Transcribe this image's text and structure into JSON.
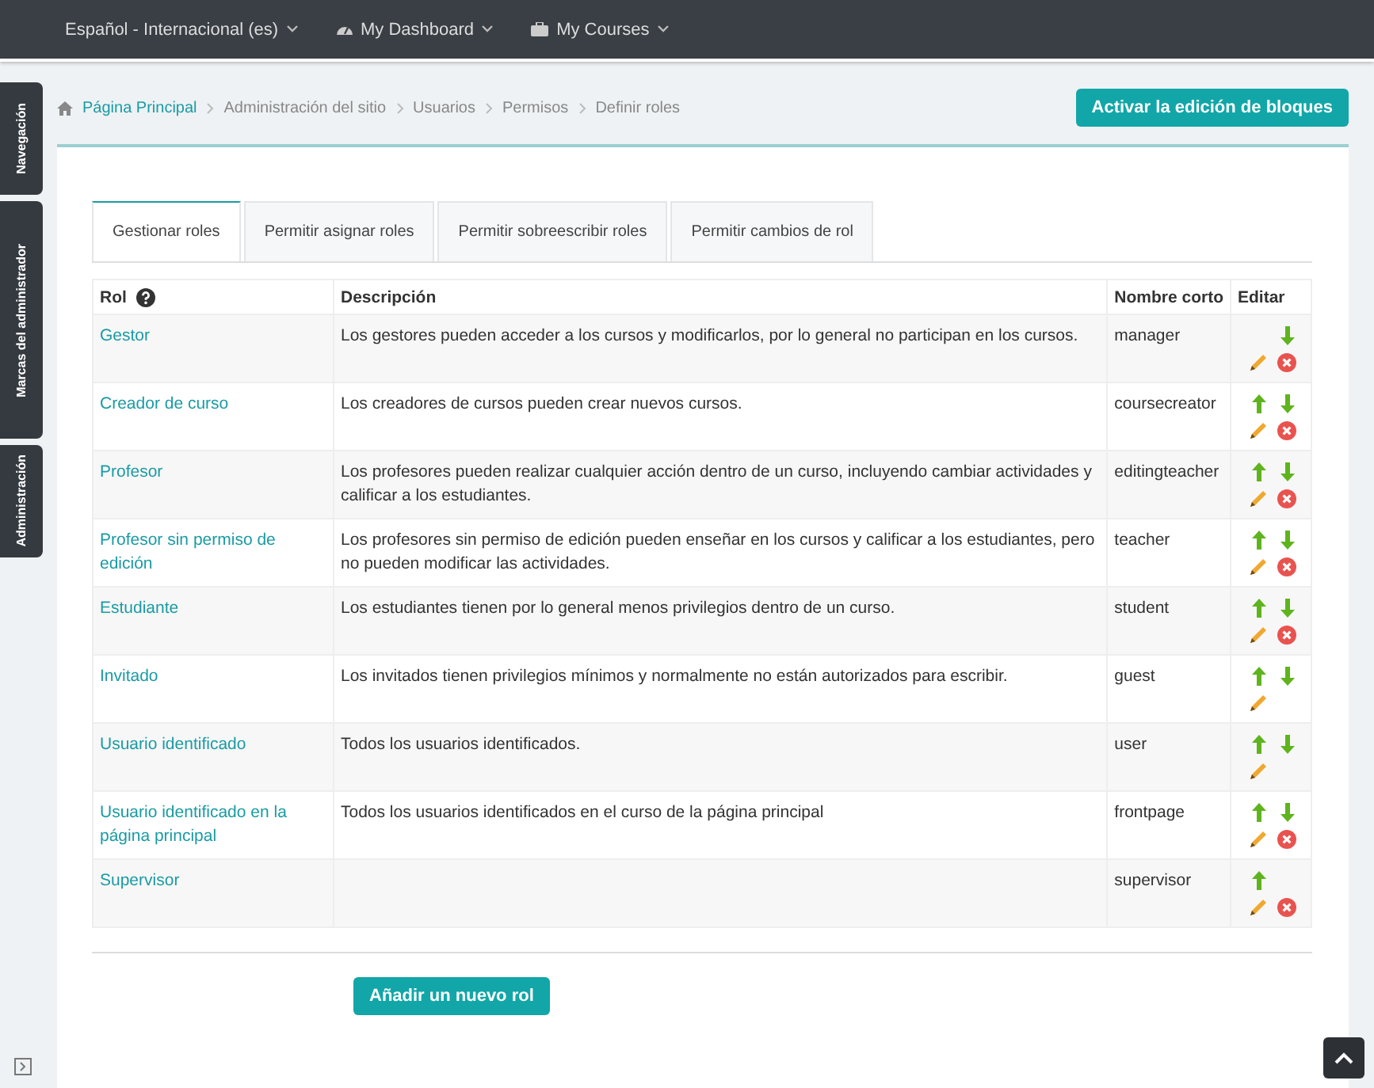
{
  "navbar": {
    "items": [
      {
        "label": "Español - Internacional (es)"
      },
      {
        "label": "My Dashboard"
      },
      {
        "label": "My Courses"
      }
    ]
  },
  "side_tabs": [
    "Navegación",
    "Marcas del administrador",
    "Administración"
  ],
  "breadcrumb": [
    {
      "label": "Página Principal",
      "link": true
    },
    {
      "label": "Administración del sitio",
      "link": false
    },
    {
      "label": "Usuarios",
      "link": false
    },
    {
      "label": "Permisos",
      "link": false
    },
    {
      "label": "Definir roles",
      "link": false
    }
  ],
  "edit_blocks_button": "Activar la edición de bloques",
  "tabs": [
    {
      "label": "Gestionar roles",
      "selected": true
    },
    {
      "label": "Permitir asignar roles",
      "selected": false
    },
    {
      "label": "Permitir sobreescribir roles",
      "selected": false
    },
    {
      "label": "Permitir cambios de rol",
      "selected": false
    }
  ],
  "table": {
    "columns": [
      "Rol",
      "Descripción",
      "Nombre corto",
      "Editar"
    ],
    "rows": [
      {
        "role": "Gestor",
        "description": "Los gestores pueden acceder a los cursos y modificarlos, por lo general no participan en los cursos.",
        "shortname": "manager",
        "up": false,
        "down": true,
        "delete": true
      },
      {
        "role": "Creador de curso",
        "description": "Los creadores de cursos pueden crear nuevos cursos.",
        "shortname": "coursecreator",
        "up": true,
        "down": true,
        "delete": true
      },
      {
        "role": "Profesor",
        "description": "Los profesores pueden realizar cualquier acción dentro de un curso, incluyendo cambiar actividades y calificar a los estudiantes.",
        "shortname": "editingteacher",
        "up": true,
        "down": true,
        "delete": true
      },
      {
        "role": "Profesor sin permiso de edición",
        "description": "Los profesores sin permiso de edición pueden enseñar en los cursos y calificar a los estudiantes, pero no pueden modificar las actividades.",
        "shortname": "teacher",
        "up": true,
        "down": true,
        "delete": true
      },
      {
        "role": "Estudiante",
        "description": "Los estudiantes tienen por lo general menos privilegios dentro de un curso.",
        "shortname": "student",
        "up": true,
        "down": true,
        "delete": true
      },
      {
        "role": "Invitado",
        "description": "Los invitados tienen privilegios mínimos y normalmente no están autorizados para escribir.",
        "shortname": "guest",
        "up": true,
        "down": true,
        "delete": false
      },
      {
        "role": "Usuario identificado",
        "description": "Todos los usuarios identificados.",
        "shortname": "user",
        "up": true,
        "down": true,
        "delete": false
      },
      {
        "role": "Usuario identificado en la página principal",
        "description": "Todos los usuarios identificados en el curso de la página principal",
        "shortname": "frontpage",
        "up": true,
        "down": true,
        "delete": true
      },
      {
        "role": "Supervisor",
        "shortname": "supervisor",
        "up": true,
        "down": false,
        "delete": true
      }
    ]
  },
  "add_role_button": "Añadir un nuevo rol"
}
